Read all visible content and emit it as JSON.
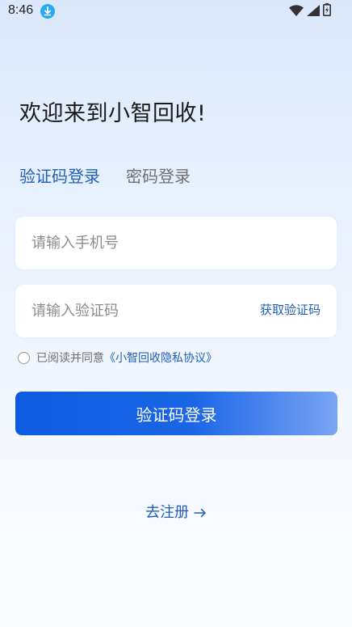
{
  "status_bar": {
    "time": "8:46",
    "icons": [
      "download-icon",
      "wifi-icon",
      "signal-icon",
      "battery-icon"
    ]
  },
  "welcome_title": "欢迎来到小智回收!",
  "tabs": [
    {
      "label": "验证码登录",
      "active": true
    },
    {
      "label": "密码登录",
      "active": false
    }
  ],
  "form": {
    "phone_placeholder": "请输入手机号",
    "code_placeholder": "请输入验证码",
    "get_code_label": "获取验证码"
  },
  "agreement": {
    "prefix": "已阅读并同意",
    "link": "《小智回收隐私协议》",
    "checked": false
  },
  "login_button": "验证码登录",
  "register_link": "去注册",
  "colors": {
    "accent": "#1f5fb8",
    "button_start": "#0e5be0",
    "button_end": "#7aa5f2",
    "download_icon": "#2aa9f0"
  }
}
